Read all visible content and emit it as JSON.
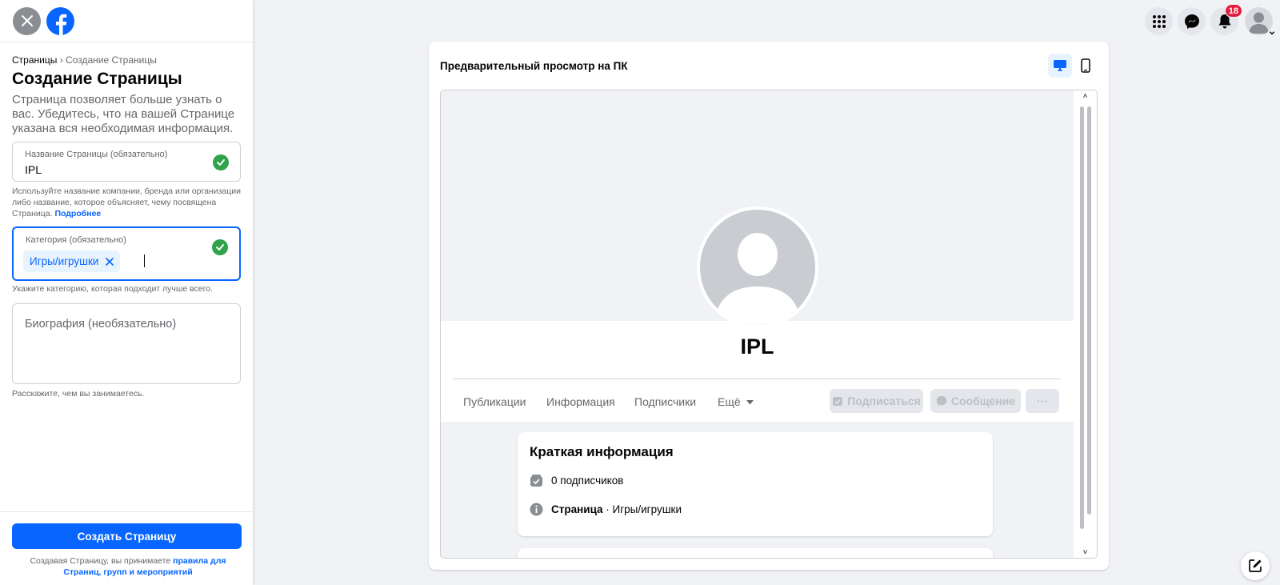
{
  "sidebar": {
    "breadcrumb": {
      "parent": "Страницы",
      "separator": "›",
      "current": "Создание Страницы"
    },
    "title": "Создание Страницы",
    "description": "Страница позволяет больше узнать о вас. Убедитесь, что на вашей Странице указана вся необходимая информация.",
    "name_field": {
      "label": "Название Страницы (обязательно)",
      "value": "IPL",
      "help": "Используйте название компании, бренда или организации либо название, которое объясняет, чему посвящена Страница.",
      "help_link": "Подробнее"
    },
    "category_field": {
      "label": "Категория (обязательно)",
      "chip": "Игры/игрушки",
      "help": "Укажите категорию, которая подходит лучше всего."
    },
    "bio_field": {
      "placeholder": "Биография (необязательно)",
      "help": "Расскажите, чем вы занимаетесь."
    },
    "create_button": "Создать Страницу",
    "terms_text": "Создавая Страницу, вы принимаете",
    "terms_link": "правила для Страниц, групп и мероприятий"
  },
  "topbar": {
    "notifications_count": "18",
    "icons": [
      "menu-grid-icon",
      "messenger-icon",
      "bell-icon",
      "profile-avatar-icon"
    ]
  },
  "preview": {
    "title": "Предварительный просмотр на ПК",
    "page_name": "IPL",
    "tabs": [
      "Публикации",
      "Информация",
      "Подписчики",
      "Ещё"
    ],
    "buttons": {
      "follow": "Подписаться",
      "message": "Сообщение",
      "more": "···"
    },
    "about": {
      "title": "Краткая информация",
      "followers": "0 подписчиков",
      "page_label": "Страница",
      "page_category": " · Игры/игрушки"
    }
  },
  "colors": {
    "accent": "#0866ff",
    "check_green": "#31a24c",
    "badge_red": "#e41e3f",
    "background": "#f0f2f5"
  }
}
